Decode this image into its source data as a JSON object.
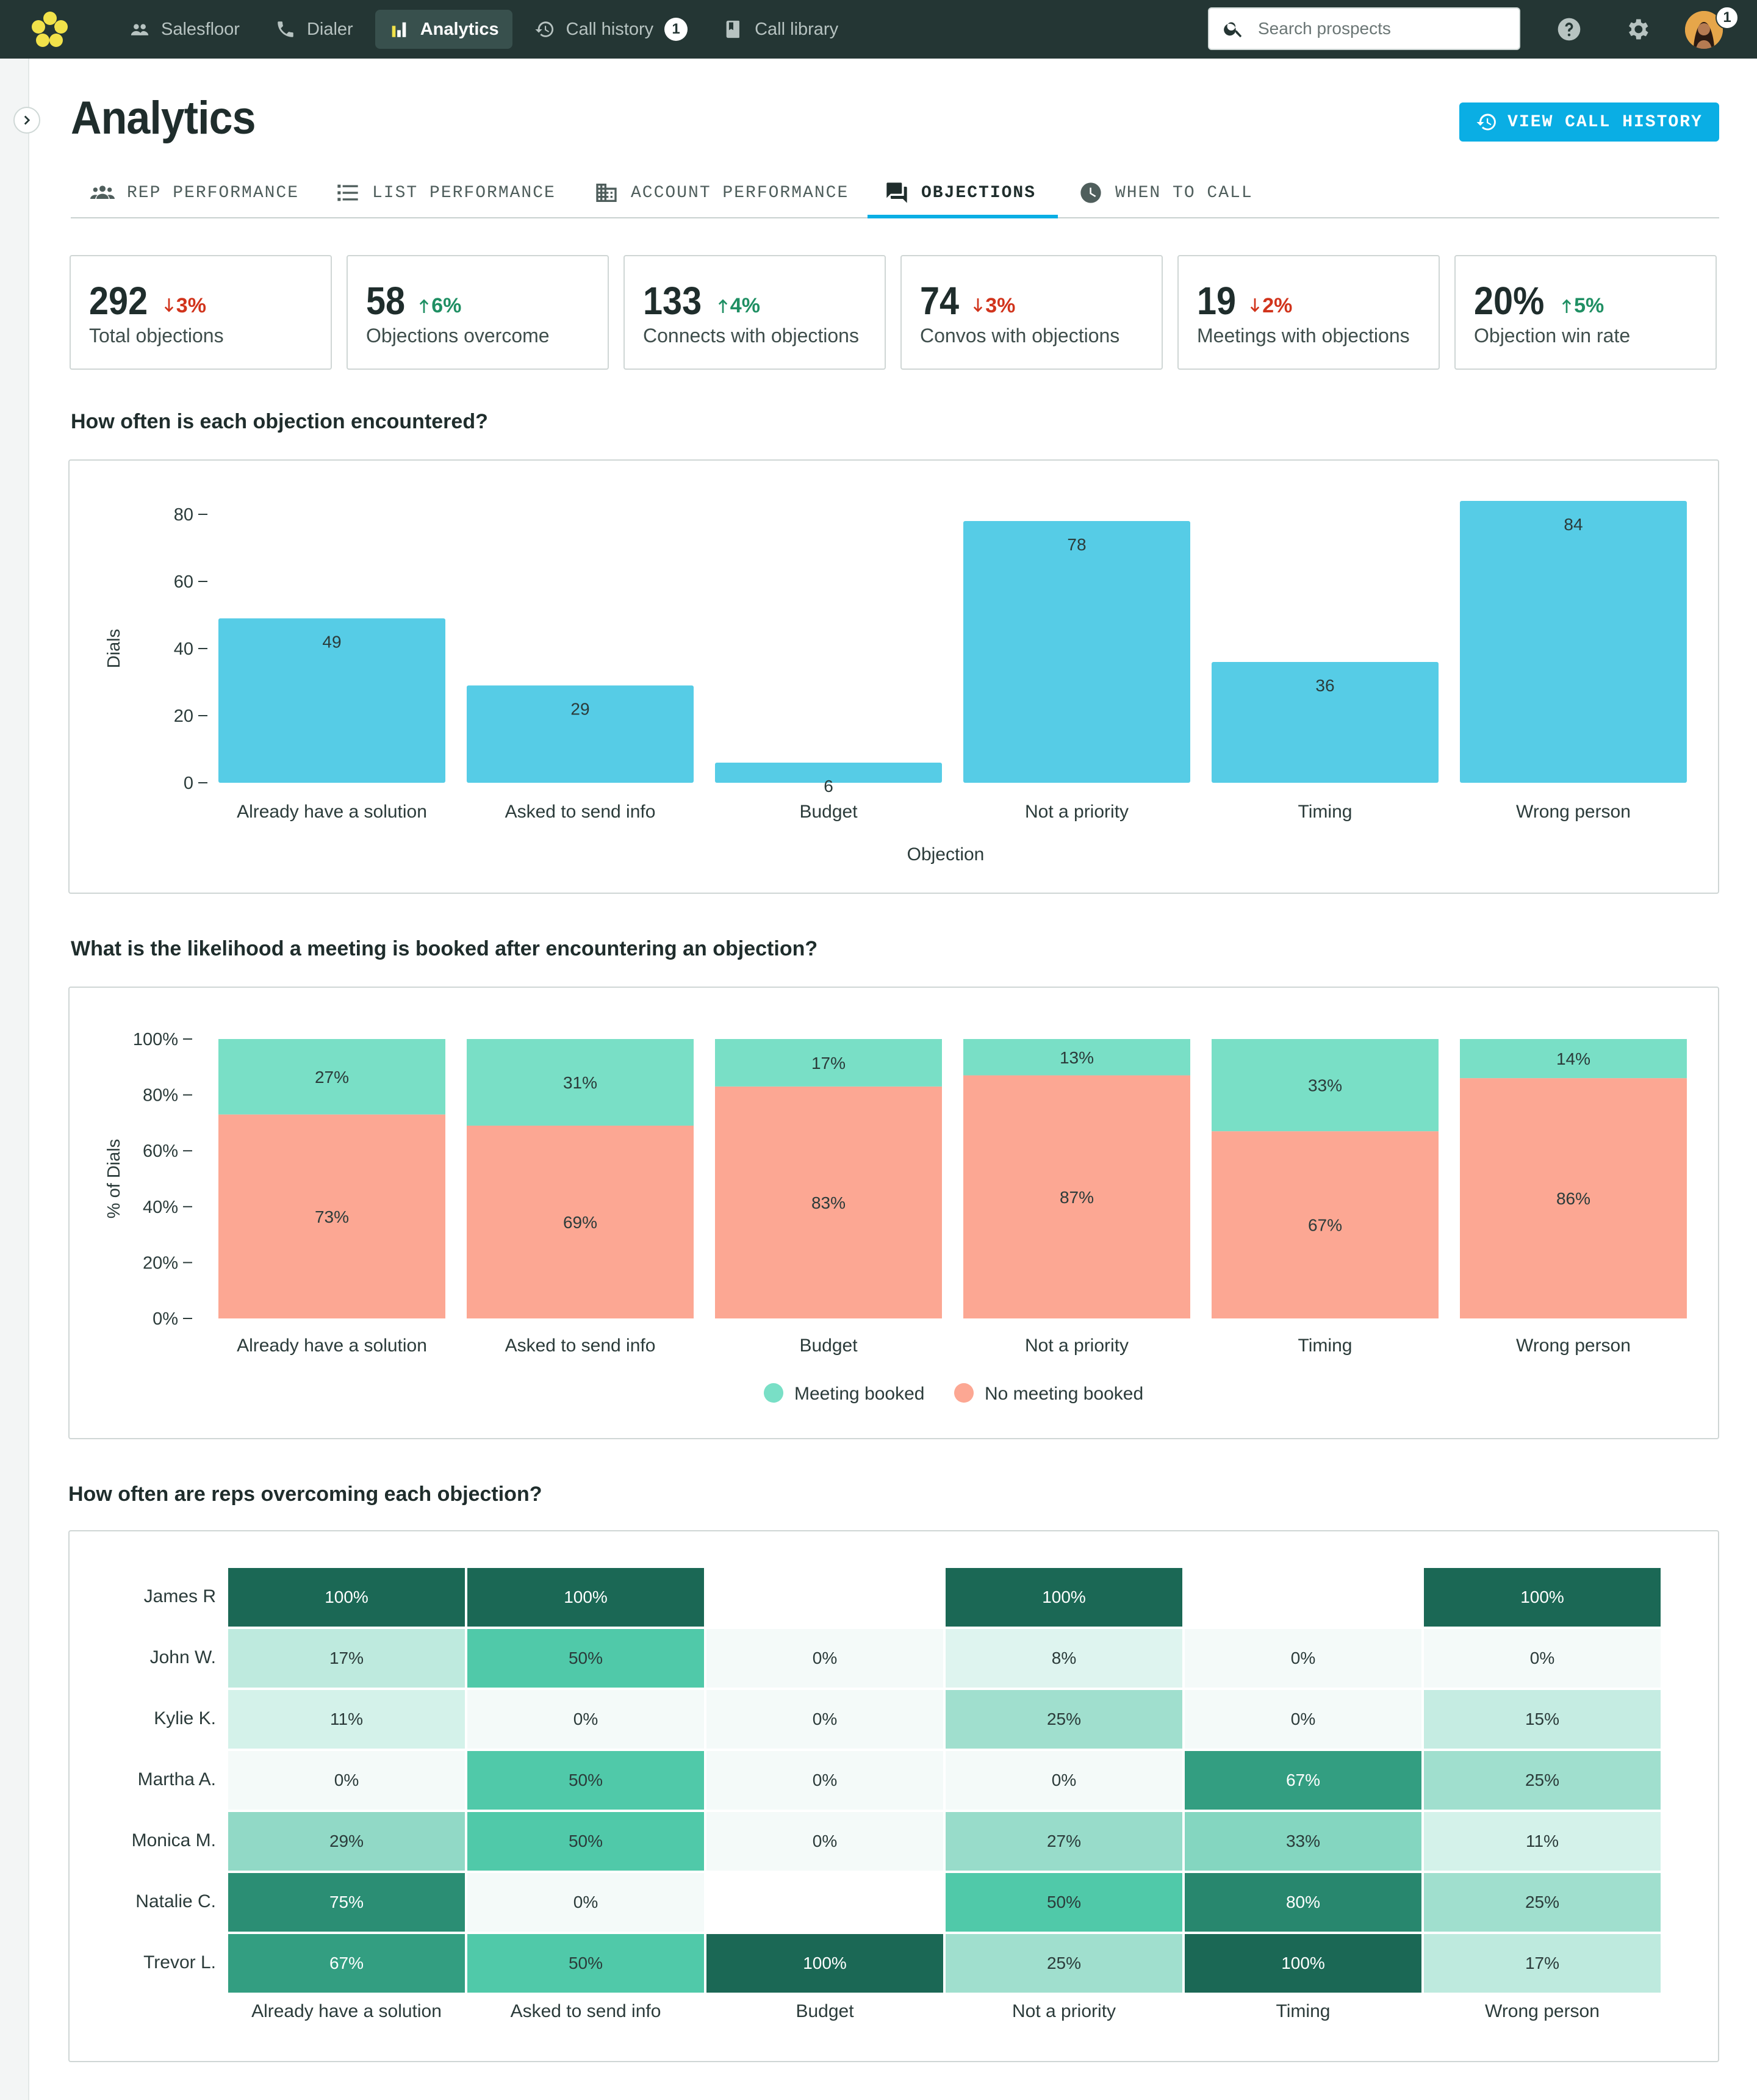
{
  "nav": {
    "items": [
      {
        "label": "Salesfloor",
        "icon": "people-icon"
      },
      {
        "label": "Dialer",
        "icon": "phone-icon"
      },
      {
        "label": "Analytics",
        "icon": "bar-chart-icon",
        "active": true
      },
      {
        "label": "Call history",
        "icon": "history-icon",
        "badge": "1"
      },
      {
        "label": "Call library",
        "icon": "book-icon"
      }
    ],
    "search_placeholder": "Search prospects",
    "avatar_badge": "1"
  },
  "page": {
    "title": "Analytics",
    "view_history_label": "VIEW CALL HISTORY"
  },
  "tabs": [
    {
      "label": "REP PERFORMANCE",
      "icon": "team-icon"
    },
    {
      "label": "LIST PERFORMANCE",
      "icon": "list-icon"
    },
    {
      "label": "ACCOUNT PERFORMANCE",
      "icon": "building-icon"
    },
    {
      "label": "OBJECTIONS",
      "icon": "chat-icon",
      "active": true
    },
    {
      "label": "WHEN TO CALL",
      "icon": "clock-icon"
    }
  ],
  "stats": [
    {
      "value": "292",
      "delta": "3%",
      "direction": "down",
      "label": "Total objections"
    },
    {
      "value": "58",
      "delta": "6%",
      "direction": "up",
      "label": "Objections overcome"
    },
    {
      "value": "133",
      "delta": "4%",
      "direction": "up",
      "label": "Connects with objections"
    },
    {
      "value": "74",
      "delta": "3%",
      "direction": "down",
      "label": "Convos with objections"
    },
    {
      "value": "19",
      "delta": "2%",
      "direction": "down",
      "label": "Meetings with objections"
    },
    {
      "value": "20%",
      "delta": "5%",
      "direction": "up",
      "label": "Objection win rate"
    }
  ],
  "colors": {
    "bar": "#56cce6",
    "meeting": "#79dfc6",
    "no_meeting": "#fca793",
    "accent": "#0aaee4",
    "nav_bg": "#243634",
    "down": "#d1341c",
    "up": "#1f8f63"
  },
  "sections": {
    "encounter_title": "How often is each objection encountered?",
    "likelihood_title": "What is the likelihood a meeting is booked after encountering an objection?",
    "overcome_title": "How often are reps overcoming each objection?"
  },
  "chart_data": [
    {
      "type": "bar",
      "categories": [
        "Already have a solution",
        "Asked to send info",
        "Budget",
        "Not a priority",
        "Timing",
        "Wrong person"
      ],
      "values": [
        49,
        29,
        6,
        78,
        36,
        84
      ],
      "xlabel": "Objection",
      "ylabel": "Dials",
      "ylim": [
        0,
        80
      ],
      "yticks": [
        "80",
        "60",
        "40",
        "20",
        "0"
      ],
      "grid": false
    },
    {
      "type": "bar",
      "stacked": true,
      "categories": [
        "Already have a solution",
        "Asked to send info",
        "Budget",
        "Not a priority",
        "Timing",
        "Wrong person"
      ],
      "series": [
        {
          "name": "Meeting booked",
          "values": [
            27,
            31,
            17,
            13,
            33,
            14
          ],
          "labels": [
            "27%",
            "31%",
            "17%",
            "13%",
            "33%",
            "14%"
          ]
        },
        {
          "name": "No meeting booked",
          "values": [
            73,
            69,
            83,
            87,
            67,
            86
          ],
          "labels": [
            "73%",
            "69%",
            "83%",
            "87%",
            "67%",
            "86%"
          ]
        }
      ],
      "ylabel": "% of Dials",
      "ylim": [
        0,
        100
      ],
      "yticks": [
        "100%",
        "80%",
        "60%",
        "40%",
        "20%",
        "0%"
      ],
      "legend": "bottom-center"
    },
    {
      "type": "heatmap",
      "rows": [
        "James R",
        "John W.",
        "Kylie K.",
        "Martha A.",
        "Monica M.",
        "Natalie C.",
        "Trevor L."
      ],
      "columns": [
        "Already have a solution",
        "Asked to send info",
        "Budget",
        "Not a priority",
        "Timing",
        "Wrong person"
      ],
      "values": [
        [
          100,
          100,
          null,
          100,
          null,
          100
        ],
        [
          17,
          50,
          0,
          8,
          0,
          0
        ],
        [
          11,
          0,
          0,
          25,
          0,
          15
        ],
        [
          0,
          50,
          0,
          0,
          67,
          25
        ],
        [
          29,
          50,
          0,
          27,
          33,
          11
        ],
        [
          75,
          0,
          null,
          50,
          80,
          25
        ],
        [
          67,
          50,
          100,
          25,
          100,
          17
        ]
      ],
      "labels": [
        [
          "100%",
          "100%",
          "",
          "100%",
          "",
          "100%"
        ],
        [
          "17%",
          "50%",
          "0%",
          "8%",
          "0%",
          "0%"
        ],
        [
          "11%",
          "0%",
          "0%",
          "25%",
          "0%",
          "15%"
        ],
        [
          "0%",
          "50%",
          "0%",
          "0%",
          "67%",
          "25%"
        ],
        [
          "29%",
          "50%",
          "0%",
          "27%",
          "33%",
          "11%"
        ],
        [
          "75%",
          "0%",
          "",
          "50%",
          "80%",
          "25%"
        ],
        [
          "67%",
          "50%",
          "100%",
          "25%",
          "100%",
          "17%"
        ]
      ]
    }
  ]
}
